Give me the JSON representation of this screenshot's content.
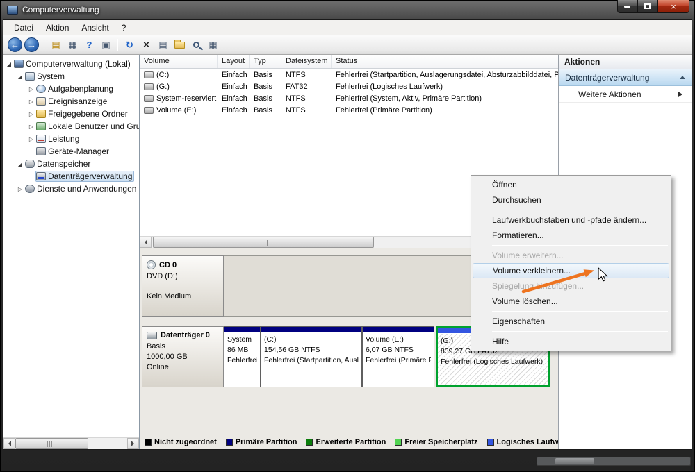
{
  "window": {
    "title": "Computerverwaltung",
    "controls": {
      "close_glyph": "×"
    }
  },
  "menubar": {
    "items": [
      {
        "label": "Datei"
      },
      {
        "label": "Aktion"
      },
      {
        "label": "Ansicht"
      },
      {
        "label": "?"
      }
    ]
  },
  "toolbar": {
    "icons": [
      {
        "name": "back-icon",
        "glyph": "←"
      },
      {
        "name": "forward-icon",
        "glyph": "→"
      },
      {
        "name": "export-list-icon",
        "glyph": "▤"
      },
      {
        "name": "show-console-tree-icon",
        "glyph": "▦"
      },
      {
        "name": "help-icon",
        "glyph": "?"
      },
      {
        "name": "console-window-icon",
        "glyph": "▣"
      },
      {
        "name": "refresh-icon",
        "glyph": "↻"
      },
      {
        "name": "delete-icon",
        "glyph": "×"
      },
      {
        "name": "properties-icon",
        "glyph": "▤"
      },
      {
        "name": "console-grid-icon",
        "glyph": "▦"
      }
    ]
  },
  "tree": {
    "items": [
      {
        "label": "Computerverwaltung (Lokal)",
        "arrow": "◢",
        "level": 0
      },
      {
        "label": "System",
        "arrow": "◢",
        "level": 1
      },
      {
        "label": "Aufgabenplanung",
        "arrow": "▷",
        "level": 2
      },
      {
        "label": "Ereignisanzeige",
        "arrow": "▷",
        "level": 2
      },
      {
        "label": "Freigegebene Ordner",
        "arrow": "▷",
        "level": 2
      },
      {
        "label": "Lokale Benutzer und Gruppen",
        "arrow": "▷",
        "level": 2
      },
      {
        "label": "Leistung",
        "arrow": "▷",
        "level": 2
      },
      {
        "label": "Geräte-Manager",
        "arrow": "",
        "level": 2
      },
      {
        "label": "Datenspeicher",
        "arrow": "◢",
        "level": 1
      },
      {
        "label": "Datenträgerverwaltung",
        "arrow": "",
        "level": 2,
        "selected": true
      },
      {
        "label": "Dienste und Anwendungen",
        "arrow": "▷",
        "level": 1
      }
    ]
  },
  "volume_list": {
    "columns": [
      "Volume",
      "Layout",
      "Typ",
      "Dateisystem",
      "Status"
    ],
    "rows": [
      {
        "volume": "(C:)",
        "layout": "Einfach",
        "typ": "Basis",
        "dateisystem": "NTFS",
        "status": "Fehlerfrei (Startpartition, Auslagerungsdatei, Absturzabbilddatei, Primäre Partition)"
      },
      {
        "volume": "(G:)",
        "layout": "Einfach",
        "typ": "Basis",
        "dateisystem": "FAT32",
        "status": "Fehlerfrei (Logisches Laufwerk)"
      },
      {
        "volume": "System-reserviert",
        "layout": "Einfach",
        "typ": "Basis",
        "dateisystem": "NTFS",
        "status": "Fehlerfrei (System, Aktiv, Primäre Partition)"
      },
      {
        "volume": "Volume (E:)",
        "layout": "Einfach",
        "typ": "Basis",
        "dateisystem": "NTFS",
        "status": "Fehlerfrei (Primäre Partition)"
      }
    ]
  },
  "graph": {
    "cd_row": {
      "name": "CD 0",
      "device": "DVD (D:)",
      "status": "Kein Medium"
    },
    "disk_row": {
      "name": "Datenträger 0",
      "typ": "Basis",
      "size": "1000,00 GB",
      "status": "Online",
      "partitions": [
        {
          "name": "System",
          "size": "86 MB",
          "status": "Fehlerfrei (System, Aktiv, Primäre Partition)",
          "color": "#000080"
        },
        {
          "name": "(C:)",
          "size": "154,56 GB NTFS",
          "status": "Fehlerfrei (Startpartition, Auslagerungsdatei)",
          "color": "#000080"
        },
        {
          "name": "Volume  (E:)",
          "size": "6,07 GB NTFS",
          "status": "Fehlerfrei (Primäre Partition)",
          "color": "#000080"
        },
        {
          "name": "(G:)",
          "size": "839,27 GB FAT32",
          "status": "Fehlerfrei (Logisches Laufwerk)",
          "color": "#3355e0"
        }
      ]
    }
  },
  "legend": {
    "items": [
      {
        "label": "Nicht zugeordnet",
        "color": "#000000"
      },
      {
        "label": "Primäre Partition",
        "color": "#000080"
      },
      {
        "label": "Erweiterte Partition",
        "color": "#0b7d0b"
      },
      {
        "label": "Freier Speicherplatz",
        "color": "#52d452"
      },
      {
        "label": "Logisches Laufwerk",
        "color": "#3355e0"
      }
    ]
  },
  "actions": {
    "title": "Aktionen",
    "group": "Datenträgerverwaltung",
    "more": "Weitere Aktionen"
  },
  "context_menu": {
    "items": [
      {
        "label": "Öffnen",
        "state": "normal"
      },
      {
        "label": "Durchsuchen",
        "state": "normal"
      },
      {
        "label": "Laufwerkbuchstaben und -pfade ändern...",
        "state": "normal"
      },
      {
        "label": "Formatieren...",
        "state": "normal"
      },
      {
        "label": "Volume erweitern...",
        "state": "disabled"
      },
      {
        "label": "Volume verkleinern...",
        "state": "highlighted"
      },
      {
        "label": "Spiegelung hinzufügen...",
        "state": "disabled"
      },
      {
        "label": "Volume löschen...",
        "state": "normal"
      },
      {
        "label": "Eigenschaften",
        "state": "normal"
      },
      {
        "label": "Hilfe",
        "state": "normal"
      }
    ]
  },
  "annotation": {
    "arrow_color": "#ee7420"
  }
}
